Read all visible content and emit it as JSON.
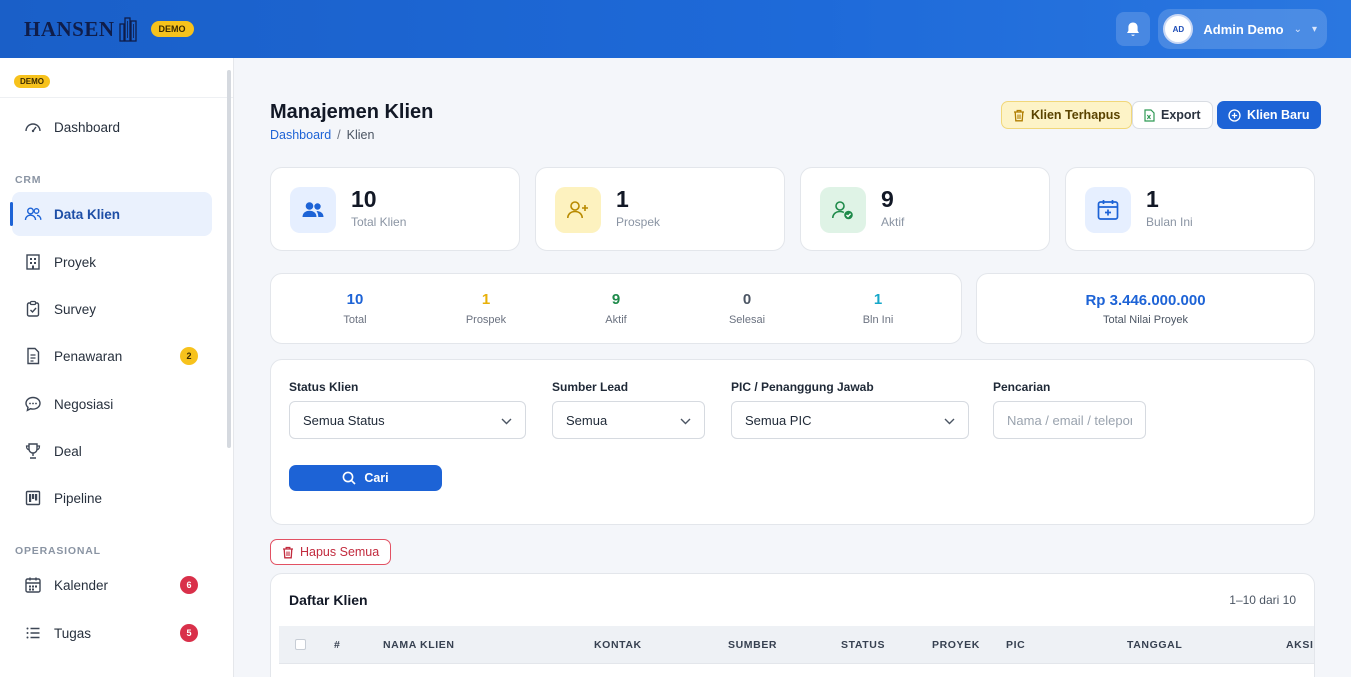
{
  "header": {
    "logo_text": "HANSEN",
    "demo_badge": "DEMO",
    "user_initials": "AD",
    "user_name": "Admin Demo",
    "icons": [
      "bell-icon",
      "chevron-down-icon",
      "caret-down-icon"
    ]
  },
  "sidebar": {
    "demo_badge": "DEMO",
    "items": [
      {
        "label": "Dashboard",
        "icon": "gauge-icon"
      },
      {
        "label": "Data Klien",
        "icon": "users-icon",
        "active": true
      },
      {
        "label": "Proyek",
        "icon": "building-icon"
      },
      {
        "label": "Survey",
        "icon": "clipboard-icon"
      },
      {
        "label": "Penawaran",
        "icon": "document-icon",
        "badge": "2"
      },
      {
        "label": "Negosiasi",
        "icon": "chat-icon"
      },
      {
        "label": "Deal",
        "icon": "trophy-icon"
      },
      {
        "label": "Pipeline",
        "icon": "kanban-icon"
      },
      {
        "label": "Kalender",
        "icon": "calendar-icon",
        "badge": "6"
      },
      {
        "label": "Tugas",
        "icon": "list-icon",
        "badge": "5"
      }
    ],
    "sections": {
      "crm": "CRM",
      "operasional": "OPERASIONAL"
    }
  },
  "page": {
    "title": "Manajemen Klien",
    "breadcrumb": {
      "home": "Dashboard",
      "sep": "/",
      "current": "Klien"
    },
    "actions": {
      "deleted": "Klien Terhapus",
      "export": "Export",
      "new": "Klien Baru"
    }
  },
  "stats": [
    {
      "value": "10",
      "label": "Total Klien",
      "icon": "users-icon",
      "bg": "#e6efff",
      "fg": "#1d63d6"
    },
    {
      "value": "1",
      "label": "Prospek",
      "icon": "user-plus-icon",
      "bg": "#fdf2bf",
      "fg": "#b88a00"
    },
    {
      "value": "9",
      "label": "Aktif",
      "icon": "user-check-icon",
      "bg": "#dff3e6",
      "fg": "#1e8a4a"
    },
    {
      "value": "1",
      "label": "Bulan Ini",
      "icon": "calendar-plus-icon",
      "bg": "#e6efff",
      "fg": "#1d63d6"
    }
  ],
  "summary": [
    {
      "value": "10",
      "label": "Total",
      "color": "#1d63d6"
    },
    {
      "value": "1",
      "label": "Prospek",
      "color": "#e8b009"
    },
    {
      "value": "9",
      "label": "Aktif",
      "color": "#1e8a4a"
    },
    {
      "value": "0",
      "label": "Selesai",
      "color": "#4b5563"
    },
    {
      "value": "1",
      "label": "Bln Ini",
      "color": "#16a7c9"
    }
  ],
  "total_project": {
    "value": "Rp 3.446.000.000",
    "label": "Total Nilai Proyek"
  },
  "filters": {
    "status_label": "Status Klien",
    "status_value": "Semua Status",
    "source_label": "Sumber Lead",
    "source_value": "Semua",
    "pic_label": "PIC / Penanggung Jawab",
    "pic_value": "Semua PIC",
    "search_label": "Pencarian",
    "search_placeholder": "Nama / email / telepon",
    "search_button": "Cari"
  },
  "delete_all": "Hapus Semua",
  "table": {
    "title": "Daftar Klien",
    "count": "1–10 dari 10",
    "columns": [
      "#",
      "NAMA KLIEN",
      "KONTAK",
      "SUMBER",
      "STATUS",
      "PROYEK",
      "PIC",
      "TANGGAL",
      "AKSI"
    ]
  }
}
